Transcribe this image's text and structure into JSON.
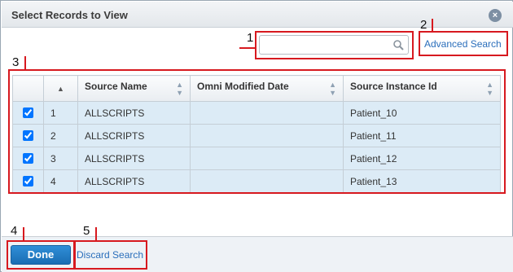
{
  "dialog": {
    "title": "Select Records to View",
    "close_label": "×"
  },
  "search": {
    "placeholder": "",
    "value": ""
  },
  "advanced_search_label": "Advanced Search",
  "table": {
    "columns": [
      "",
      "",
      "Source Name",
      "Omni Modified Date",
      "Source Instance Id"
    ],
    "rows": [
      {
        "checked": true,
        "index": "1",
        "source_name": "ALLSCRIPTS",
        "modified_date": "",
        "instance_id": "Patient_10"
      },
      {
        "checked": true,
        "index": "2",
        "source_name": "ALLSCRIPTS",
        "modified_date": "",
        "instance_id": "Patient_11"
      },
      {
        "checked": true,
        "index": "3",
        "source_name": "ALLSCRIPTS",
        "modified_date": "",
        "instance_id": "Patient_12"
      },
      {
        "checked": true,
        "index": "4",
        "source_name": "ALLSCRIPTS",
        "modified_date": "",
        "instance_id": "Patient_13"
      }
    ]
  },
  "footer": {
    "done_label": "Done",
    "discard_label": "Discard Search"
  },
  "callouts": {
    "n1": "1",
    "n2": "2",
    "n3": "3",
    "n4": "4",
    "n5": "5"
  },
  "colors": {
    "callout": "#d7191f",
    "row_bg": "#dcebf6",
    "link": "#2a6ebb",
    "button": "#1a6db3"
  }
}
